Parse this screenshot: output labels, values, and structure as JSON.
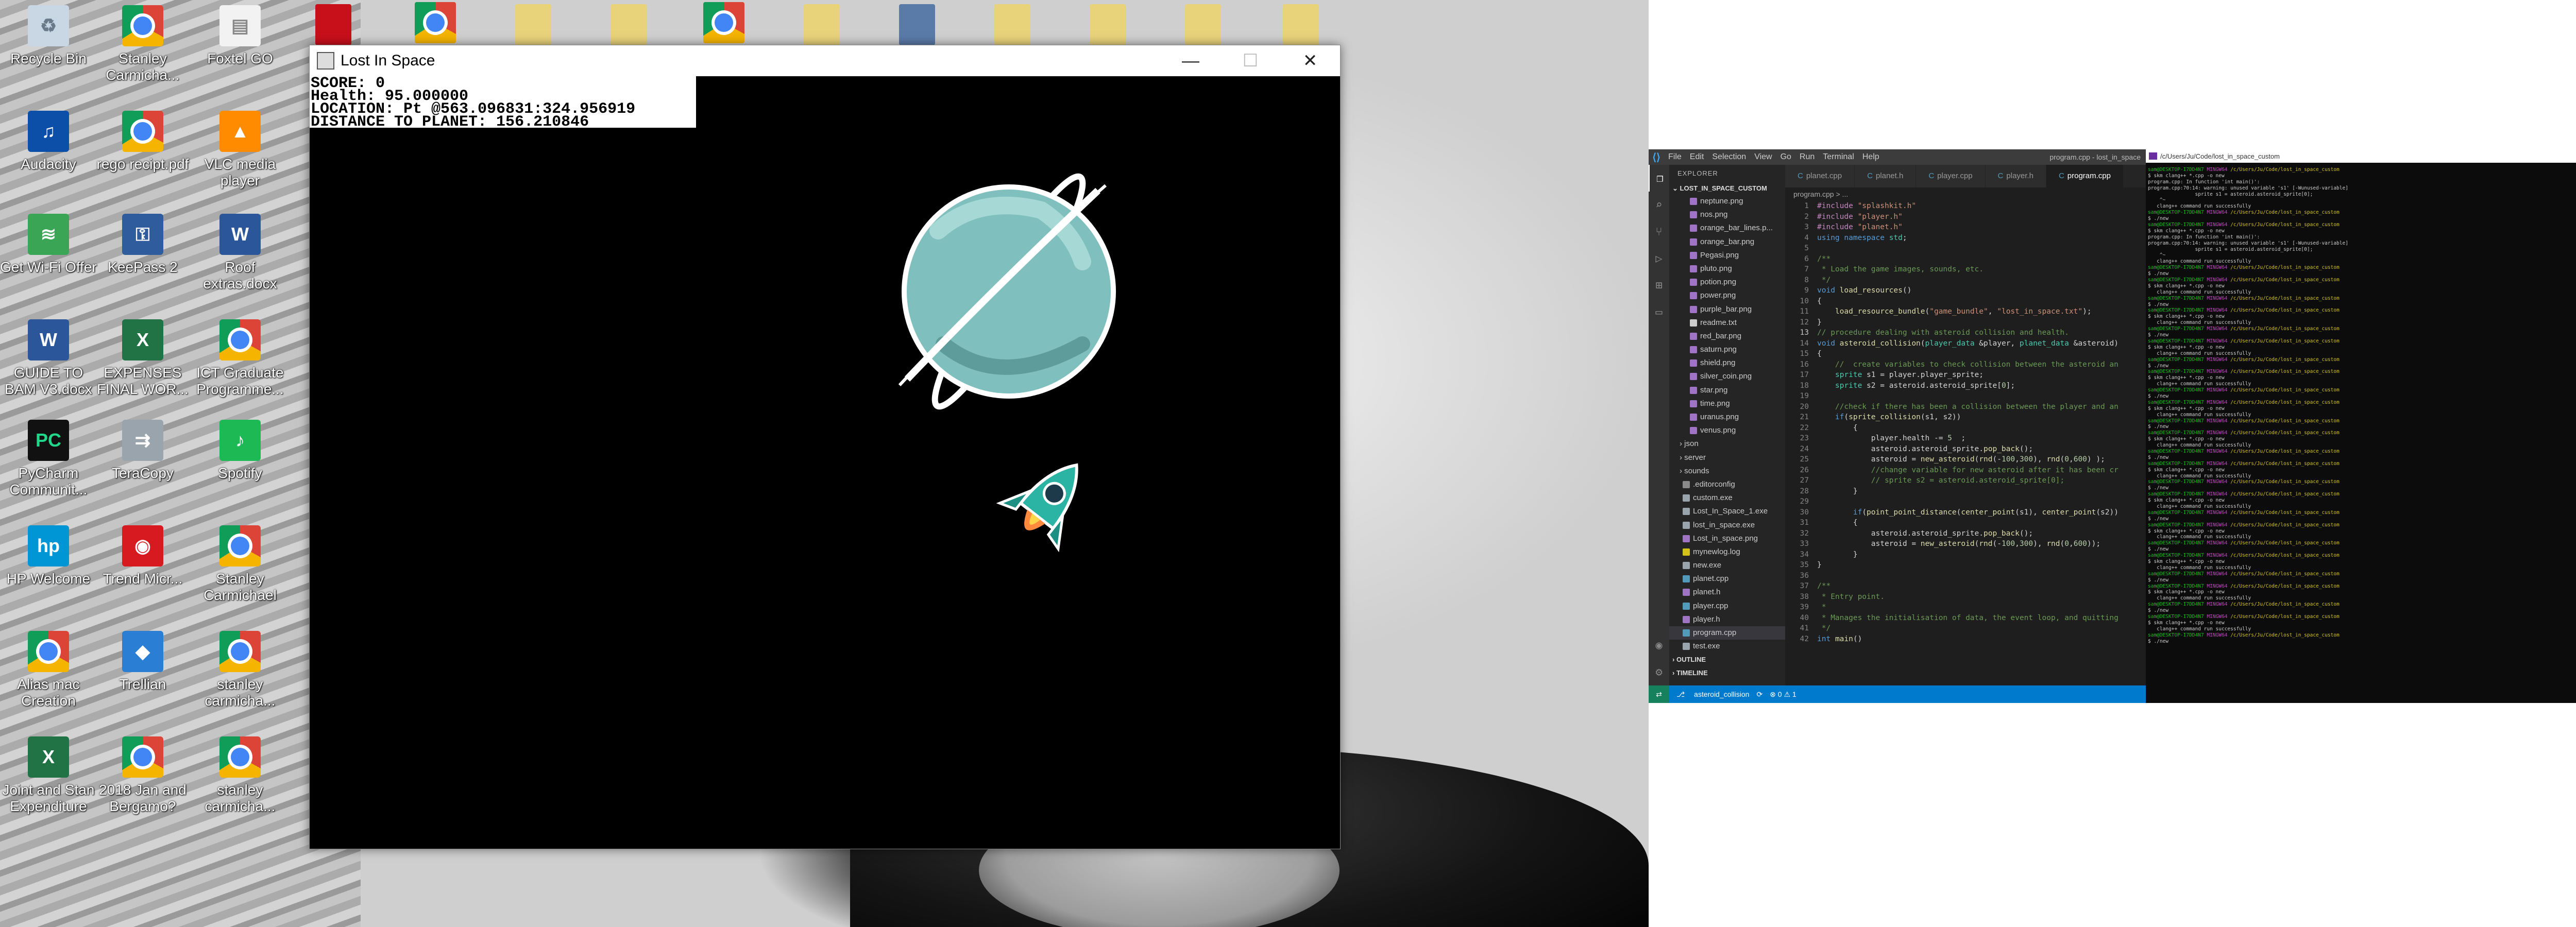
{
  "desktop": {
    "icons": [
      {
        "id": "recycle",
        "label": "Recycle Bin",
        "kind": "recycle"
      },
      {
        "id": "chrome-stanley1",
        "label": "Stanley Carmicha...",
        "kind": "chrome"
      },
      {
        "id": "foxtel",
        "label": "Foxtel GO",
        "kind": "file"
      },
      {
        "id": "audacity",
        "label": "Audacity",
        "kind": "audacity"
      },
      {
        "id": "rego",
        "label": "rego recipt.pdf",
        "kind": "chrome"
      },
      {
        "id": "vlc",
        "label": "VLC media player",
        "kind": "vlc"
      },
      {
        "id": "getwifi",
        "label": "Get Wi-Fi Offer",
        "kind": "wifi"
      },
      {
        "id": "keepass",
        "label": "KeePass 2",
        "kind": "keepass"
      },
      {
        "id": "roof",
        "label": "Roof extras.docx",
        "kind": "word"
      },
      {
        "id": "guide",
        "label": "GUIDE TO BAM V3.docx",
        "kind": "word"
      },
      {
        "id": "expenses",
        "label": "EXPENSES FINAL WOR...",
        "kind": "excel"
      },
      {
        "id": "ictgrad",
        "label": "ICT Graduate Programme...",
        "kind": "chrome"
      },
      {
        "id": "pycharm",
        "label": "PyCharm Communit...",
        "kind": "pycharm"
      },
      {
        "id": "teracopy",
        "label": "TeraCopy",
        "kind": "teracopy"
      },
      {
        "id": "spotify",
        "label": "Spotify",
        "kind": "spotify"
      },
      {
        "id": "hp",
        "label": "HP Welcome",
        "kind": "hp"
      },
      {
        "id": "trendmicro",
        "label": "Trend Micr...",
        "kind": "trend"
      },
      {
        "id": "chrome-stanley2",
        "label": "Stanley Carmichael",
        "kind": "chrome"
      },
      {
        "id": "alias",
        "label": "Alias mac Creation",
        "kind": "chrome"
      },
      {
        "id": "trellian",
        "label": "Trellian",
        "kind": "trellian"
      },
      {
        "id": "chrome-stanley3",
        "label": "stanley carmicha...",
        "kind": "chrome"
      },
      {
        "id": "joint",
        "label": "Joint and Stan Expenditure",
        "kind": "excel"
      },
      {
        "id": "bergamo",
        "label": "2018 Jan and Bergamo?",
        "kind": "chrome"
      },
      {
        "id": "chrome-stanley4",
        "label": "stanley carmicha...",
        "kind": "chrome"
      }
    ]
  },
  "game": {
    "window_title": "Lost In Space",
    "hud": {
      "score": "SCORE: 0",
      "health": "Health: 95.000000",
      "location": "LOCATION: Pt @563.096831:324.956919",
      "distance": "DISTANCE TO PLANET: 156.210846"
    },
    "controls": {
      "minimize": "—",
      "maximize": "☐",
      "close": "✕"
    }
  },
  "vscode": {
    "menu": [
      "File",
      "Edit",
      "Selection",
      "View",
      "Go",
      "Run",
      "Terminal",
      "Help"
    ],
    "window_title": "program.cpp - lost_in_space",
    "explorer_title": "EXPLORER",
    "root_folder": "LOST_IN_SPACE_CUSTOM",
    "files": [
      {
        "name": "neptune.png",
        "kind": "png"
      },
      {
        "name": "nos.png",
        "kind": "png"
      },
      {
        "name": "orange_bar_lines.p...",
        "kind": "png"
      },
      {
        "name": "orange_bar.png",
        "kind": "png"
      },
      {
        "name": "Pegasi.png",
        "kind": "png"
      },
      {
        "name": "pluto.png",
        "kind": "png"
      },
      {
        "name": "potion.png",
        "kind": "png"
      },
      {
        "name": "power.png",
        "kind": "png"
      },
      {
        "name": "purple_bar.png",
        "kind": "png"
      },
      {
        "name": "readme.txt",
        "kind": "txt"
      },
      {
        "name": "red_bar.png",
        "kind": "png"
      },
      {
        "name": "saturn.png",
        "kind": "png"
      },
      {
        "name": "shield.png",
        "kind": "png"
      },
      {
        "name": "silver_coin.png",
        "kind": "png"
      },
      {
        "name": "star.png",
        "kind": "png"
      },
      {
        "name": "time.png",
        "kind": "png"
      },
      {
        "name": "uranus.png",
        "kind": "png"
      },
      {
        "name": "venus.png",
        "kind": "png"
      },
      {
        "name": "› json",
        "kind": "folder"
      },
      {
        "name": "› server",
        "kind": "folder"
      },
      {
        "name": "› sounds",
        "kind": "folder"
      },
      {
        "name": ".editorconfig",
        "kind": "cfg"
      },
      {
        "name": "custom.exe",
        "kind": "exe"
      },
      {
        "name": "Lost_In_Space_1.exe",
        "kind": "exe"
      },
      {
        "name": "lost_in_space.exe",
        "kind": "exe"
      },
      {
        "name": "Lost_in_space.png",
        "kind": "png"
      },
      {
        "name": "mynewlog.log",
        "kind": "log"
      },
      {
        "name": "new.exe",
        "kind": "exe"
      },
      {
        "name": "planet.cpp",
        "kind": "cpp"
      },
      {
        "name": "planet.h",
        "kind": "h"
      },
      {
        "name": "player.cpp",
        "kind": "cpp"
      },
      {
        "name": "player.h",
        "kind": "h"
      },
      {
        "name": "program.cpp",
        "kind": "cpp",
        "selected": true
      },
      {
        "name": "test.exe",
        "kind": "exe"
      }
    ],
    "sections": [
      "OUTLINE",
      "TIMELINE"
    ],
    "tabs": [
      {
        "label": "planet.cpp",
        "active": false
      },
      {
        "label": "planet.h",
        "active": false
      },
      {
        "label": "player.cpp",
        "active": false
      },
      {
        "label": "player.h",
        "active": false
      },
      {
        "label": "program.cpp",
        "active": true
      }
    ],
    "breadcrumb": "program.cpp > ...",
    "code": [
      "#include \"splashkit.h\"",
      "#include \"player.h\"",
      "#include \"planet.h\"",
      "using namespace std;",
      "",
      "/**",
      " * Load the game images, sounds, etc.",
      " */",
      "void load_resources()",
      "{",
      "    load_resource_bundle(\"game_bundle\", \"lost_in_space.txt\");",
      "}",
      "// procedure dealing with asteroid collision and health.",
      "void asteroid_collision(player_data &player, planet_data &asteroid)",
      "{",
      "    //  create variables to check collision between the asteroid an",
      "    sprite s1 = player.player_sprite;",
      "    sprite s2 = asteroid.asteroid_sprite[0];",
      "",
      "    //check if there has been a collision between the player and an",
      "    if(sprite_collision(s1, s2))",
      "        {",
      "            player.health -= 5  ;",
      "            asteroid.asteroid_sprite.pop_back();",
      "            asteroid = new_asteroid(rnd(-100,300), rnd(0,600) );",
      "            //change variable for new asteroid after it has been cr",
      "            // sprite s2 = asteroid.asteroid_sprite[0];",
      "        }",
      "",
      "        if(point_point_distance(center_point(s1), center_point(s2))",
      "        {",
      "            asteroid.asteroid_sprite.pop_back();",
      "            asteroid = new_asteroid(rnd(-100,300), rnd(0,600));",
      "        }",
      "}",
      "",
      "/**",
      " * Entry point.",
      " *",
      " * Manages the initialisation of data, the event loop, and quitting",
      " */",
      "int main()"
    ],
    "status": {
      "branch": "asteroid_collision",
      "sync": "⟳",
      "problems": "⊗ 0 ⚠ 1"
    }
  },
  "terminal": {
    "title": "/c/Users/Ju/Code/lost_in_space_custom",
    "lines": [
      {
        "t": "prompt",
        "user": "sam@DESKTOP-I7DD4N7",
        "sys": "MINGW64",
        "path": "/c/Users/Ju/Code/lost_in_space_custom"
      },
      {
        "t": "text",
        "v": "$ skm clang++ *.cpp -o new"
      },
      {
        "t": "text",
        "v": "program.cpp: In function 'int main()':"
      },
      {
        "t": "text",
        "v": "program.cpp:70:14: warning: unused variable 's1' [-Wunused-variable]"
      },
      {
        "t": "text",
        "v": "                sprite s1 = asteroid.asteroid_sprite[0];"
      },
      {
        "t": "text",
        "v": "    ^~"
      },
      {
        "t": "text",
        "v": "   clang++ command run successfully"
      },
      {
        "t": "prompt",
        "user": "sam@DESKTOP-I7DD4N7",
        "sys": "MINGW64",
        "path": "/c/Users/Ju/Code/lost_in_space_custom"
      },
      {
        "t": "text",
        "v": "$ ./new"
      },
      {
        "t": "prompt",
        "user": "sam@DESKTOP-I7DD4N7",
        "sys": "MINGW64",
        "path": "/c/Users/Ju/Code/lost_in_space_custom"
      },
      {
        "t": "text",
        "v": "$ skm clang++ *.cpp -o new"
      },
      {
        "t": "text",
        "v": "program.cpp: In function 'int main()':"
      },
      {
        "t": "text",
        "v": "program.cpp:70:14: warning: unused variable 's1' [-Wunused-variable]"
      },
      {
        "t": "text",
        "v": "                sprite s1 = asteroid.asteroid_sprite[0];"
      },
      {
        "t": "text",
        "v": "    ^~"
      },
      {
        "t": "text",
        "v": "   clang++ command run successfully"
      },
      {
        "t": "prompt",
        "user": "sam@DESKTOP-I7DD4N7",
        "sys": "MINGW64",
        "path": "/c/Users/Ju/Code/lost_in_space_custom"
      },
      {
        "t": "text",
        "v": "$ ./new"
      },
      {
        "t": "prompt",
        "user": "sam@DESKTOP-I7DD4N7",
        "sys": "MINGW64",
        "path": "/c/Users/Ju/Code/lost_in_space_custom"
      },
      {
        "t": "text",
        "v": "$ skm clang++ *.cpp -o new"
      },
      {
        "t": "text",
        "v": "   clang++ command run successfully"
      },
      {
        "t": "prompt",
        "user": "sam@DESKTOP-I7DD4N7",
        "sys": "MINGW64",
        "path": "/c/Users/Ju/Code/lost_in_space_custom"
      },
      {
        "t": "text",
        "v": "$ ./new"
      },
      {
        "t": "prompt",
        "user": "sam@DESKTOP-I7DD4N7",
        "sys": "MINGW64",
        "path": "/c/Users/Ju/Code/lost_in_space_custom"
      },
      {
        "t": "text",
        "v": "$ skm clang++ *.cpp -o new"
      },
      {
        "t": "text",
        "v": "   clang++ command run successfully"
      },
      {
        "t": "prompt",
        "user": "sam@DESKTOP-I7DD4N7",
        "sys": "MINGW64",
        "path": "/c/Users/Ju/Code/lost_in_space_custom"
      },
      {
        "t": "text",
        "v": "$ ./new"
      },
      {
        "t": "prompt",
        "user": "sam@DESKTOP-I7DD4N7",
        "sys": "MINGW64",
        "path": "/c/Users/Ju/Code/lost_in_space_custom"
      },
      {
        "t": "text",
        "v": "$ skm clang++ *.cpp -o new"
      },
      {
        "t": "text",
        "v": "   clang++ command run successfully"
      },
      {
        "t": "prompt",
        "user": "sam@DESKTOP-I7DD4N7",
        "sys": "MINGW64",
        "path": "/c/Users/Ju/Code/lost_in_space_custom"
      },
      {
        "t": "text",
        "v": "$ ./new"
      },
      {
        "t": "prompt",
        "user": "sam@DESKTOP-I7DD4N7",
        "sys": "MINGW64",
        "path": "/c/Users/Ju/Code/lost_in_space_custom"
      },
      {
        "t": "text",
        "v": "$ skm clang++ *.cpp -o new"
      },
      {
        "t": "text",
        "v": "   clang++ command run successfully"
      },
      {
        "t": "prompt",
        "user": "sam@DESKTOP-I7DD4N7",
        "sys": "MINGW64",
        "path": "/c/Users/Ju/Code/lost_in_space_custom"
      },
      {
        "t": "text",
        "v": "$ ./new"
      },
      {
        "t": "prompt",
        "user": "sam@DESKTOP-I7DD4N7",
        "sys": "MINGW64",
        "path": "/c/Users/Ju/Code/lost_in_space_custom"
      },
      {
        "t": "text",
        "v": "$ skm clang++ *.cpp -o new"
      },
      {
        "t": "text",
        "v": "   clang++ command run successfully"
      },
      {
        "t": "prompt",
        "user": "sam@DESKTOP-I7DD4N7",
        "sys": "MINGW64",
        "path": "/c/Users/Ju/Code/lost_in_space_custom"
      },
      {
        "t": "text",
        "v": "$ ./new"
      },
      {
        "t": "prompt",
        "user": "sam@DESKTOP-I7DD4N7",
        "sys": "MINGW64",
        "path": "/c/Users/Ju/Code/lost_in_space_custom"
      },
      {
        "t": "text",
        "v": "$ skm clang++ *.cpp -o new"
      },
      {
        "t": "text",
        "v": "   clang++ command run successfully"
      },
      {
        "t": "prompt",
        "user": "sam@DESKTOP-I7DD4N7",
        "sys": "MINGW64",
        "path": "/c/Users/Ju/Code/lost_in_space_custom"
      },
      {
        "t": "text",
        "v": "$ ./new"
      },
      {
        "t": "prompt",
        "user": "sam@DESKTOP-I7DD4N7",
        "sys": "MINGW64",
        "path": "/c/Users/Ju/Code/lost_in_space_custom"
      },
      {
        "t": "text",
        "v": "$ skm clang++ *.cpp -o new"
      },
      {
        "t": "text",
        "v": "   clang++ command run successfully"
      },
      {
        "t": "prompt",
        "user": "sam@DESKTOP-I7DD4N7",
        "sys": "MINGW64",
        "path": "/c/Users/Ju/Code/lost_in_space_custom"
      },
      {
        "t": "text",
        "v": "$ ./new"
      },
      {
        "t": "prompt",
        "user": "sam@DESKTOP-I7DD4N7",
        "sys": "MINGW64",
        "path": "/c/Users/Ju/Code/lost_in_space_custom"
      },
      {
        "t": "text",
        "v": "$ skm clang++ *.cpp -o new"
      },
      {
        "t": "text",
        "v": "   clang++ command run successfully"
      },
      {
        "t": "prompt",
        "user": "sam@DESKTOP-I7DD4N7",
        "sys": "MINGW64",
        "path": "/c/Users/Ju/Code/lost_in_space_custom"
      },
      {
        "t": "text",
        "v": "$ ./new"
      },
      {
        "t": "prompt",
        "user": "sam@DESKTOP-I7DD4N7",
        "sys": "MINGW64",
        "path": "/c/Users/Ju/Code/lost_in_space_custom"
      },
      {
        "t": "text",
        "v": "$ skm clang++ *.cpp -o new"
      },
      {
        "t": "text",
        "v": "   clang++ command run successfully"
      },
      {
        "t": "prompt",
        "user": "sam@DESKTOP-I7DD4N7",
        "sys": "MINGW64",
        "path": "/c/Users/Ju/Code/lost_in_space_custom"
      },
      {
        "t": "text",
        "v": "$ ./new"
      },
      {
        "t": "prompt",
        "user": "sam@DESKTOP-I7DD4N7",
        "sys": "MINGW64",
        "path": "/c/Users/Ju/Code/lost_in_space_custom"
      },
      {
        "t": "text",
        "v": "$ skm clang++ *.cpp -o new"
      },
      {
        "t": "text",
        "v": "   clang++ command run successfully"
      },
      {
        "t": "prompt",
        "user": "sam@DESKTOP-I7DD4N7",
        "sys": "MINGW64",
        "path": "/c/Users/Ju/Code/lost_in_space_custom"
      },
      {
        "t": "text",
        "v": "$ ./new"
      },
      {
        "t": "prompt",
        "user": "sam@DESKTOP-I7DD4N7",
        "sys": "MINGW64",
        "path": "/c/Users/Ju/Code/lost_in_space_custom"
      },
      {
        "t": "text",
        "v": "$ skm clang++ *.cpp -o new"
      },
      {
        "t": "text",
        "v": "   clang++ command run successfully"
      },
      {
        "t": "prompt",
        "user": "sam@DESKTOP-I7DD4N7",
        "sys": "MINGW64",
        "path": "/c/Users/Ju/Code/lost_in_space_custom"
      },
      {
        "t": "text",
        "v": "$ ./new"
      },
      {
        "t": "prompt",
        "user": "sam@DESKTOP-I7DD4N7",
        "sys": "MINGW64",
        "path": "/c/Users/Ju/Code/lost_in_space_custom"
      },
      {
        "t": "text",
        "v": "$ skm clang++ *.cpp -o new"
      },
      {
        "t": "text",
        "v": "   clang++ command run successfully"
      },
      {
        "t": "prompt",
        "user": "sam@DESKTOP-I7DD4N7",
        "sys": "MINGW64",
        "path": "/c/Users/Ju/Code/lost_in_space_custom"
      },
      {
        "t": "text",
        "v": "$ ./new"
      }
    ]
  },
  "colors": {
    "game_bg": "#000000",
    "planet_body": "#7fbfbd",
    "ring": "#ffffff",
    "rocket_body": "#2bb3a3",
    "vscode_status": "#007acc",
    "terminal_prompt_user": "#13c313",
    "terminal_prompt_sys": "#c840c8",
    "terminal_prompt_path": "#d4c21a"
  }
}
